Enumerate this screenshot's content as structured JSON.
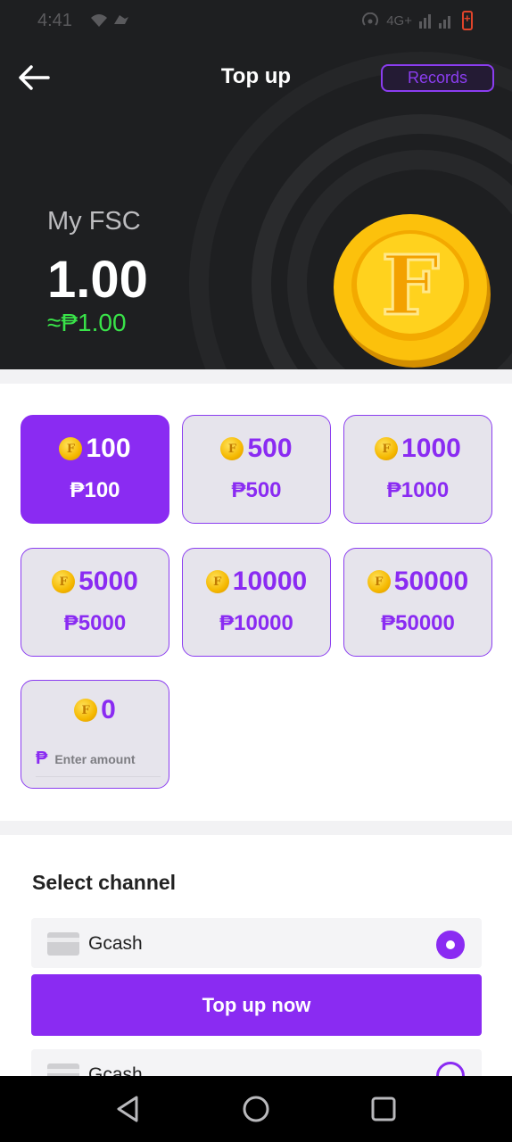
{
  "status_bar": {
    "time": "4:41",
    "left_icons": "wifi-icon, bird-icon",
    "network": "4G+",
    "battery_color": "#e0442a"
  },
  "header": {
    "title": "Top up",
    "records_label": "Records",
    "back_icon": "back-arrow-icon"
  },
  "balance": {
    "label": "My FSC",
    "value": "1.00",
    "php_value": "≈₱1.00",
    "coin_letter": "F"
  },
  "packages": [
    {
      "coins": "100",
      "price": "₱100",
      "selected": true
    },
    {
      "coins": "500",
      "price": "₱500",
      "selected": false
    },
    {
      "coins": "1000",
      "price": "₱1000",
      "selected": false
    },
    {
      "coins": "5000",
      "price": "₱5000",
      "selected": false
    },
    {
      "coins": "10000",
      "price": "₱10000",
      "selected": false
    },
    {
      "coins": "50000",
      "price": "₱50000",
      "selected": false
    }
  ],
  "custom_amount": {
    "coins": "0",
    "currency_symbol": "₱",
    "placeholder": "Enter amount"
  },
  "channels": {
    "title": "Select channel",
    "items": [
      {
        "name": "Gcash",
        "selected": true
      },
      {
        "name": "Gcash",
        "selected": false
      }
    ]
  },
  "action": {
    "topup_label": "Top up now"
  },
  "colors": {
    "accent": "#8a2bf2",
    "php_green": "#39e349",
    "hero_bg": "#1e1f21",
    "coin_gold": "#f5b800"
  }
}
